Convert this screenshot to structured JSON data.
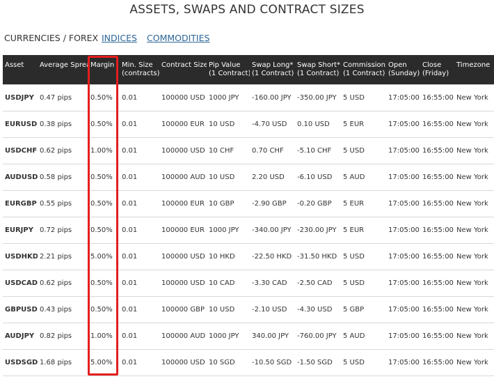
{
  "page": {
    "title": "ASSETS, SWAPS AND CONTRACT SIZES"
  },
  "tabs": [
    {
      "label": "CURRENCIES / FOREX",
      "active": true
    },
    {
      "label": "INDICES",
      "active": false
    },
    {
      "label": "COMMODITIES",
      "active": false
    }
  ],
  "table": {
    "headers": [
      {
        "line1": "Asset",
        "line2": ""
      },
      {
        "line1": "Average Spread",
        "line2": ""
      },
      {
        "line1": "Margin",
        "line2": ""
      },
      {
        "line1": "Min. Size",
        "line2": "(contracts)"
      },
      {
        "line1": "Contract Size",
        "line2": ""
      },
      {
        "line1": "Pip Value",
        "line2": "(1 Contract)"
      },
      {
        "line1": "Swap Long*",
        "line2": "(1 Contract)"
      },
      {
        "line1": "Swap Short*",
        "line2": "(1 Contract)"
      },
      {
        "line1": "Commission",
        "line2": "(1 Contract)"
      },
      {
        "line1": "Open",
        "line2": "(Sunday)"
      },
      {
        "line1": "Close",
        "line2": "(Friday)"
      },
      {
        "line1": "Timezone",
        "line2": ""
      }
    ],
    "rows": [
      [
        "USDJPY",
        "0.47 pips",
        "0.50%",
        "0.01",
        "100000 USD",
        "1000 JPY",
        "-160.00 JPY",
        "-350.00 JPY",
        "5 USD",
        "17:05:00",
        "16:55:00",
        "New York"
      ],
      [
        "EURUSD",
        "0.38 pips",
        "0.50%",
        "0.01",
        "100000 EUR",
        "10 USD",
        "-4.70 USD",
        "0.10 USD",
        "5 EUR",
        "17:05:00",
        "16:55:00",
        "New York"
      ],
      [
        "USDCHF",
        "0.62 pips",
        "1.00%",
        "0.01",
        "100000 USD",
        "10 CHF",
        "0.70 CHF",
        "-5.10 CHF",
        "5 USD",
        "17:05:00",
        "16:55:00",
        "New York"
      ],
      [
        "AUDUSD",
        "0.58 pips",
        "0.50%",
        "0.01",
        "100000 AUD",
        "10 USD",
        "2.20 USD",
        "-6.10 USD",
        "5 AUD",
        "17:05:00",
        "16:55:00",
        "New York"
      ],
      [
        "EURGBP",
        "0.55 pips",
        "0.50%",
        "0.01",
        "100000 EUR",
        "10 GBP",
        "-2.90 GBP",
        "-0.20 GBP",
        "5 EUR",
        "17:05:00",
        "16:55:00",
        "New York"
      ],
      [
        "EURJPY",
        "0.72 pips",
        "0.50%",
        "0.01",
        "100000 EUR",
        "1000 JPY",
        "-340.00 JPY",
        "-230.00 JPY",
        "5 EUR",
        "17:05:00",
        "16:55:00",
        "New York"
      ],
      [
        "USDHKD",
        "2.21 pips",
        "5.00%",
        "0.01",
        "100000 USD",
        "10 HKD",
        "-22.50 HKD",
        "-31.50 HKD",
        "5 USD",
        "17:05:00",
        "16:55:00",
        "New York"
      ],
      [
        "USDCAD",
        "0.62 pips",
        "0.50%",
        "0.01",
        "100000 USD",
        "10 CAD",
        "-3.30 CAD",
        "-2.50 CAD",
        "5 USD",
        "17:05:00",
        "16:55:00",
        "New York"
      ],
      [
        "GBPUSD",
        "0.43 pips",
        "0.50%",
        "0.01",
        "100000 GBP",
        "10 USD",
        "-2.10 USD",
        "-4.30 USD",
        "5 GBP",
        "17:05:00",
        "16:55:00",
        "New York"
      ],
      [
        "AUDJPY",
        "0.82 pips",
        "1.00%",
        "0.01",
        "100000 AUD",
        "1000 JPY",
        "340.00 JPY",
        "-760.00 JPY",
        "5 AUD",
        "17:05:00",
        "16:55:00",
        "New York"
      ],
      [
        "USDSGD",
        "1.68 pips",
        "5.00%",
        "0.01",
        "100000 USD",
        "10 SGD",
        "-10.50 SGD",
        "-1.50 SGD",
        "5 USD",
        "17:05:00",
        "16:55:00",
        "New York"
      ]
    ]
  },
  "highlight": {
    "color": "#e41e1e"
  }
}
